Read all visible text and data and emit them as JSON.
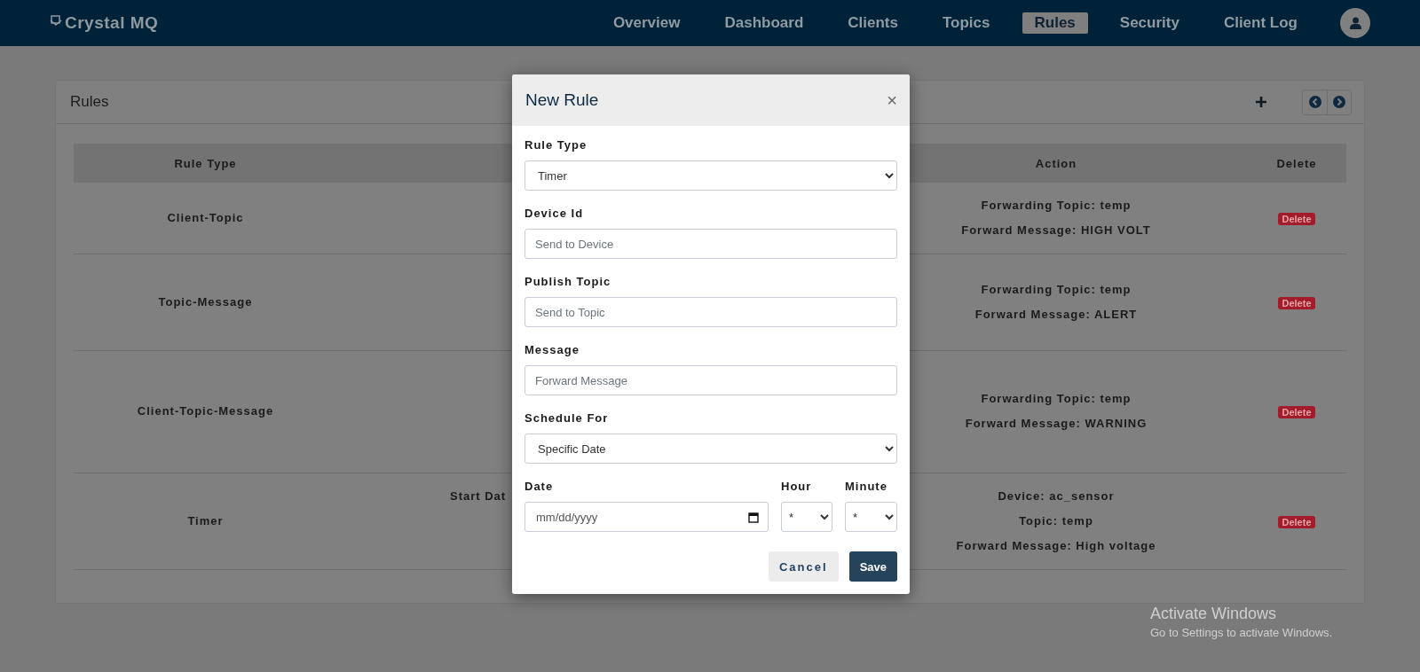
{
  "navbar": {
    "logo": "Crystal MQ",
    "items": [
      {
        "label": "Overview",
        "selected": false
      },
      {
        "label": "Dashboard",
        "selected": false
      },
      {
        "label": "Clients",
        "selected": false
      },
      {
        "label": "Topics",
        "selected": false
      },
      {
        "label": "Rules",
        "selected": true
      },
      {
        "label": "Security",
        "selected": false
      },
      {
        "label": "Client Log",
        "selected": false
      }
    ]
  },
  "panel": {
    "title": "Rules",
    "columns": [
      "Rule Type",
      "Action",
      "Delete"
    ],
    "rows": [
      {
        "rule_type": "Client-Topic",
        "action": [
          "Forwarding Topic: temp",
          "Forward Message: HIGH VOLT"
        ],
        "delete": "Delete"
      },
      {
        "rule_type": "Topic-Message",
        "action": [
          "Forwarding Topic: temp",
          "Forward Message: ALERT"
        ],
        "delete": "Delete"
      },
      {
        "rule_type": "Client-Topic-Message",
        "action": [
          "Forwarding Topic: temp",
          "Forward Message: WARNING"
        ],
        "delete": "Delete"
      },
      {
        "rule_type": "Timer",
        "column_2": "Start Dat",
        "action": [
          "Device: ac_sensor",
          "Topic: temp",
          "Forward Message: High voltage"
        ],
        "delete": "Delete"
      }
    ]
  },
  "dialog": {
    "title": "New Rule",
    "close": "×",
    "fields": [
      {
        "kind": "select",
        "label": "Rule Type",
        "value": "Timer"
      },
      {
        "kind": "input",
        "label": "Device Id",
        "placeholder": "Send to Device"
      },
      {
        "kind": "input",
        "label": "Publish Topic",
        "placeholder": "Send to Topic"
      },
      {
        "kind": "input",
        "label": "Message",
        "placeholder": "Forward Message"
      },
      {
        "kind": "select",
        "label": "Schedule For",
        "value": "Specific Date"
      }
    ],
    "date": {
      "label": "Date",
      "placeholder": "mm/dd/yyyy"
    },
    "hour": {
      "label": "Hour",
      "value": "*"
    },
    "minute": {
      "label": "Minute",
      "value": "*"
    },
    "buttons": [
      {
        "kind": "secondary",
        "label": "Cancel"
      },
      {
        "kind": "primary",
        "label": "Save"
      }
    ]
  },
  "os_notice": {
    "title": "Activate Windows",
    "text": "Go to Settings to activate Windows."
  }
}
